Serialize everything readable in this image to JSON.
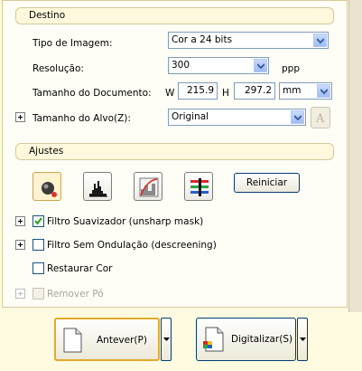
{
  "destination": {
    "header": "Destino",
    "image_type": {
      "label": "Tipo de Imagem:",
      "value": "Cor a 24 bits"
    },
    "resolution": {
      "label": "Resolução:",
      "value": "300",
      "unit": "ppp"
    },
    "document_size": {
      "label": "Tamanho do Documento:",
      "w_label": "W",
      "w_value": "215.9",
      "h_label": "H",
      "h_value": "297.2",
      "unit": "mm"
    },
    "target_size": {
      "label": "Tamanho do Alvo(Z):",
      "value": "Original"
    }
  },
  "adjustments": {
    "header": "Ajustes",
    "reset_label": "Reiniciar",
    "options": [
      {
        "label": "Filtro Suavizador (unsharp mask)",
        "checked": true,
        "expand": true,
        "enabled": true
      },
      {
        "label": "Filtro Sem Ondulação (descreening)",
        "checked": false,
        "expand": true,
        "enabled": true
      },
      {
        "label": "Restaurar Cor",
        "checked": false,
        "expand": false,
        "enabled": true
      },
      {
        "label": "Remover Pó",
        "checked": false,
        "expand": true,
        "enabled": false
      }
    ]
  },
  "actions": {
    "preview_label": "Antever(P)",
    "scan_label": "Digitalizar(S)"
  }
}
